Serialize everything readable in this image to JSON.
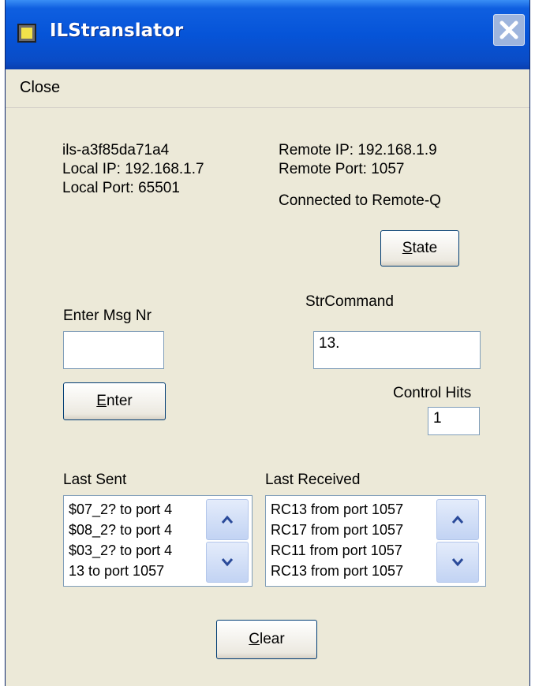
{
  "window": {
    "title": "ILStranslator"
  },
  "menu": {
    "close_label": "Close"
  },
  "info": {
    "hostname": "ils-a3f85da71a4",
    "local_ip": "Local IP: 192.168.1.7",
    "local_port": "Local Port: 65501",
    "remote_ip": "Remote IP: 192.168.1.9",
    "remote_port": "Remote Port: 1057",
    "status": "Connected to Remote-Q"
  },
  "buttons": {
    "state": {
      "mnemonic": "S",
      "rest": "tate"
    },
    "enter": {
      "mnemonic": "E",
      "rest": "nter"
    },
    "clear": {
      "mnemonic": "C",
      "rest": "lear"
    }
  },
  "msg": {
    "label": "Enter Msg Nr",
    "value": ""
  },
  "command": {
    "label": "StrCommand",
    "value": "13."
  },
  "control_hits": {
    "label": "Control Hits",
    "value": "1"
  },
  "last_sent": {
    "label": "Last Sent",
    "items": [
      "$07_2? to port 4",
      "$08_2? to port 4",
      "$03_2? to port 4",
      "13 to port 1057"
    ]
  },
  "last_received": {
    "label": "Last Received",
    "items": [
      "RC13 from port 1057",
      "RC17 from port 1057",
      "RC11 from port 1057",
      "RC13 from port 1057"
    ]
  },
  "colors": {
    "titlebar": "#0654d8",
    "face": "#ece9d8",
    "field_border": "#7f9db9"
  },
  "icons": {
    "app": "app-window-icon",
    "close": "close-icon",
    "up": "chevron-up-icon",
    "down": "chevron-down-icon"
  }
}
